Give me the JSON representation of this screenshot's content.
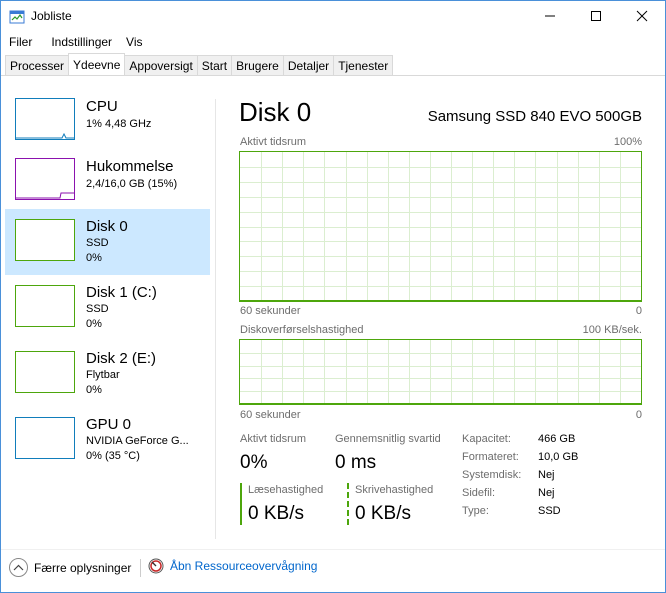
{
  "window": {
    "title": "Jobliste",
    "minimize": "—",
    "maximize": "☐",
    "close": "✕"
  },
  "menu": [
    "Filer",
    "Indstillinger",
    "Vis"
  ],
  "tabs": [
    "Processer",
    "Ydeevne",
    "Appoversigt",
    "Start",
    "Brugere",
    "Detaljer",
    "Tjenester"
  ],
  "active_tab": "Ydeevne",
  "sidebar": [
    {
      "name": "CPU",
      "line1": "1% 4,48 GHz",
      "line2": "",
      "color": "#117dbb"
    },
    {
      "name": "Hukommelse",
      "line1": "2,4/16,0 GB (15%)",
      "line2": "",
      "color": "#8b12ae"
    },
    {
      "name": "Disk 0",
      "line1": "SSD",
      "line2": "0%",
      "color": "#4da60c"
    },
    {
      "name": "Disk 1 (C:)",
      "line1": "SSD",
      "line2": "0%",
      "color": "#4da60c"
    },
    {
      "name": "Disk 2 (E:)",
      "line1": "Flytbar",
      "line2": "0%",
      "color": "#4da60c"
    },
    {
      "name": "GPU 0",
      "line1": "NVIDIA GeForce G...",
      "line2": "0% (35 °C)",
      "color": "#117dbb"
    }
  ],
  "selected_sidebar": "Disk 0",
  "detail": {
    "title": "Disk 0",
    "model": "Samsung SSD 840 EVO 500GB",
    "graph1": {
      "label": "Aktivt tidsrum",
      "max": "100%",
      "time": "60 sekunder",
      "min": "0"
    },
    "graph2": {
      "label": "Diskoverførselshastighed",
      "max": "100 KB/sek.",
      "time": "60 sekunder",
      "min": "0"
    },
    "active_time_label": "Aktivt tidsrum",
    "active_time_value": "0%",
    "response_label": "Gennemsnitlig svartid",
    "response_value": "0 ms",
    "read_label": "Læsehastighed",
    "read_value": "0 KB/s",
    "write_label": "Skrivehastighed",
    "write_value": "0 KB/s",
    "props": [
      {
        "label": "Kapacitet:",
        "value": "466 GB"
      },
      {
        "label": "Formateret:",
        "value": "10,0 GB"
      },
      {
        "label": "Systemdisk:",
        "value": "Nej"
      },
      {
        "label": "Sidefil:",
        "value": "Nej"
      },
      {
        "label": "Type:",
        "value": "SSD"
      }
    ]
  },
  "footer": {
    "fewer_details": "Færre oplysninger",
    "resource_monitor": "Åbn Ressourceovervågning"
  },
  "colors": {
    "accent": "#4da60c",
    "selection": "#cce8ff",
    "link": "#0066cc"
  }
}
